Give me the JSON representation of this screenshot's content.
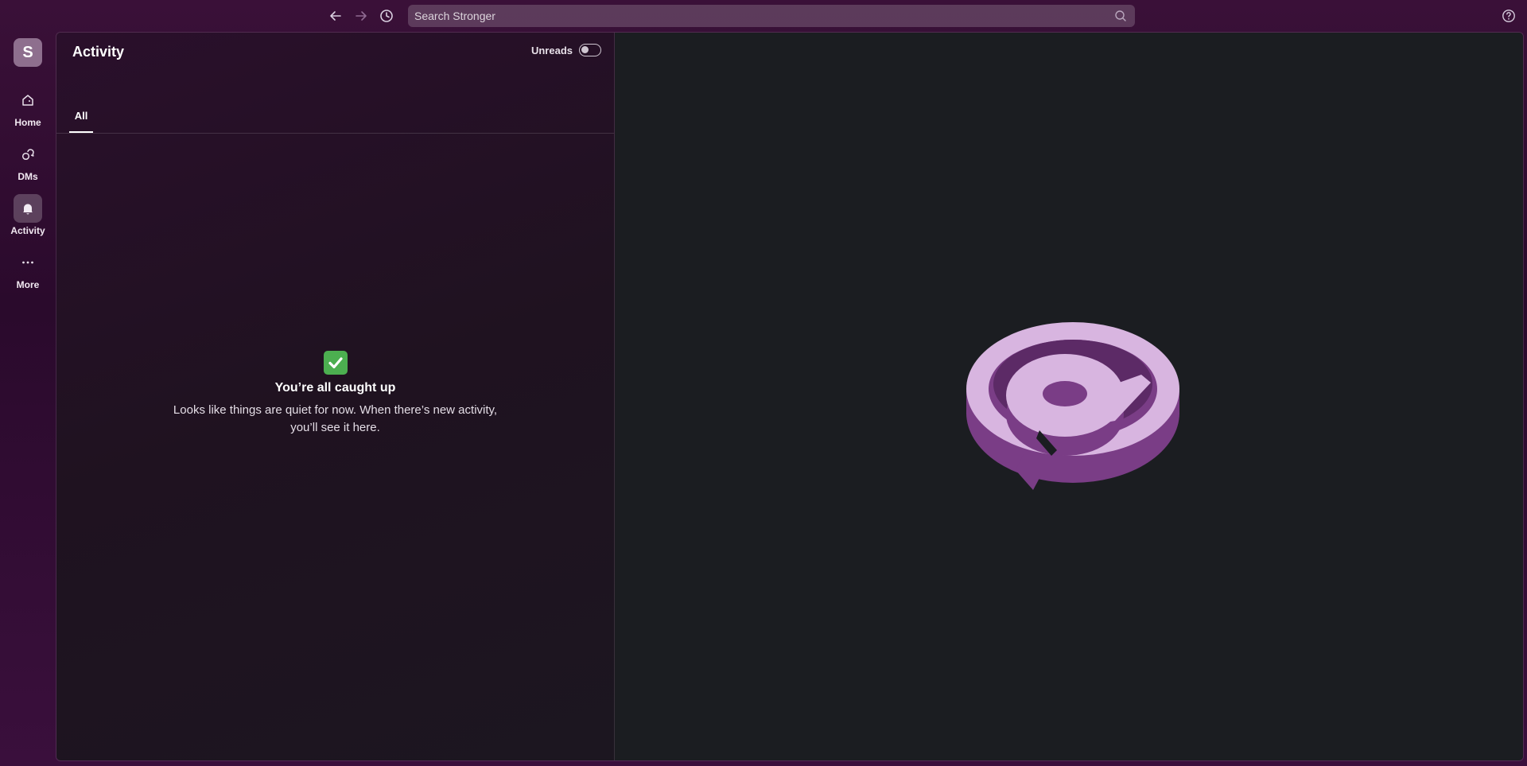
{
  "search": {
    "placeholder": "Search Stronger"
  },
  "workspace": {
    "initial": "S"
  },
  "rail": [
    {
      "label": "Home",
      "icon": "home-icon"
    },
    {
      "label": "DMs",
      "icon": "dms-icon"
    },
    {
      "label": "Activity",
      "icon": "bell-icon",
      "active": true
    },
    {
      "label": "More",
      "icon": "more-icon"
    }
  ],
  "activity": {
    "title": "Activity",
    "unreads_label": "Unreads",
    "unreads_on": false,
    "tabs": [
      {
        "label": "All",
        "active": true
      }
    ],
    "empty_title": "You’re all caught up",
    "empty_line1": "Looks like things are quiet for now. When there’s new activity,",
    "empty_line2": "you’ll see it here."
  },
  "colors": {
    "accent": "#4a154b",
    "check": "#4caf50",
    "illustration": "#d8b5e0"
  }
}
